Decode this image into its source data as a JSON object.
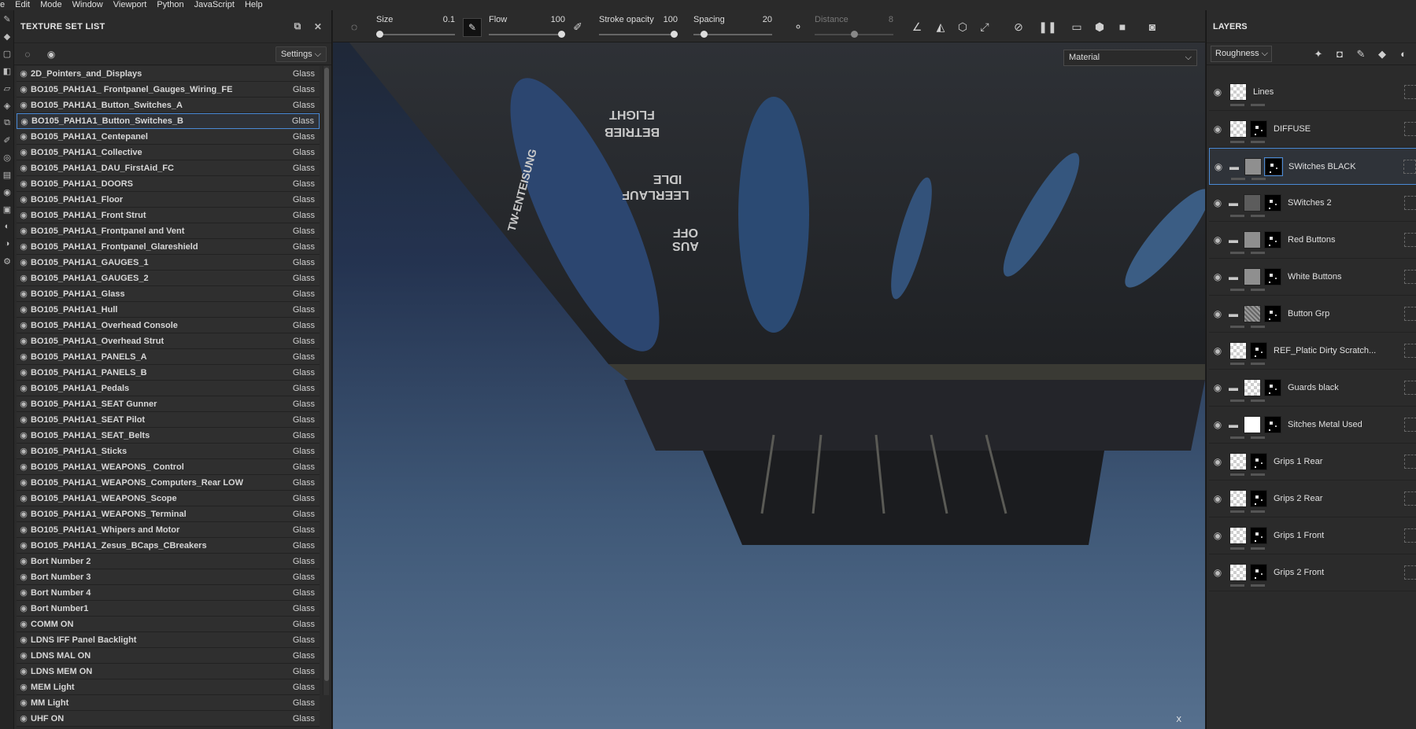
{
  "menu": [
    "e",
    "Edit",
    "Mode",
    "Window",
    "Viewport",
    "Python",
    "JavaScript",
    "Help"
  ],
  "texture_set_list": {
    "title": "TEXTURE SET LIST",
    "settings_label": "Settings",
    "settings_arrow": "⌵",
    "items": [
      {
        "name": "2D_Pointers_and_Displays",
        "shader": "Glass"
      },
      {
        "name": "BO105_PAH1A1_ Frontpanel_Gauges_Wiring_FE",
        "shader": "Glass"
      },
      {
        "name": "BO105_PAH1A1_Button_Switches_A",
        "shader": "Glass"
      },
      {
        "name": "BO105_PAH1A1_Button_Switches_B",
        "shader": "Glass",
        "selected": true
      },
      {
        "name": "BO105_PAH1A1_Centepanel",
        "shader": "Glass"
      },
      {
        "name": "BO105_PAH1A1_Collective",
        "shader": "Glass"
      },
      {
        "name": "BO105_PAH1A1_DAU_FirstAid_FC",
        "shader": "Glass"
      },
      {
        "name": "BO105_PAH1A1_DOORS",
        "shader": "Glass"
      },
      {
        "name": "BO105_PAH1A1_Floor",
        "shader": "Glass"
      },
      {
        "name": "BO105_PAH1A1_Front Strut",
        "shader": "Glass"
      },
      {
        "name": "BO105_PAH1A1_Frontpanel and Vent",
        "shader": "Glass"
      },
      {
        "name": "BO105_PAH1A1_Frontpanel_Glareshield",
        "shader": "Glass"
      },
      {
        "name": "BO105_PAH1A1_GAUGES_1",
        "shader": "Glass"
      },
      {
        "name": "BO105_PAH1A1_GAUGES_2",
        "shader": "Glass"
      },
      {
        "name": "BO105_PAH1A1_Glass",
        "shader": "Glass"
      },
      {
        "name": "BO105_PAH1A1_Hull",
        "shader": "Glass"
      },
      {
        "name": "BO105_PAH1A1_Overhead Console",
        "shader": "Glass"
      },
      {
        "name": "BO105_PAH1A1_Overhead Strut",
        "shader": "Glass"
      },
      {
        "name": "BO105_PAH1A1_PANELS_A",
        "shader": "Glass"
      },
      {
        "name": "BO105_PAH1A1_PANELS_B",
        "shader": "Glass"
      },
      {
        "name": "BO105_PAH1A1_Pedals",
        "shader": "Glass"
      },
      {
        "name": "BO105_PAH1A1_SEAT Gunner",
        "shader": "Glass"
      },
      {
        "name": "BO105_PAH1A1_SEAT Pilot",
        "shader": "Glass"
      },
      {
        "name": "BO105_PAH1A1_SEAT_Belts",
        "shader": "Glass"
      },
      {
        "name": "BO105_PAH1A1_Sticks",
        "shader": "Glass"
      },
      {
        "name": "BO105_PAH1A1_WEAPONS_ Control",
        "shader": "Glass"
      },
      {
        "name": "BO105_PAH1A1_WEAPONS_Computers_Rear LOW",
        "shader": "Glass"
      },
      {
        "name": "BO105_PAH1A1_WEAPONS_Scope",
        "shader": "Glass"
      },
      {
        "name": "BO105_PAH1A1_WEAPONS_Terminal",
        "shader": "Glass"
      },
      {
        "name": "BO105_PAH1A1_Whipers and Motor",
        "shader": "Glass"
      },
      {
        "name": "BO105_PAH1A1_Zesus_BCaps_CBreakers",
        "shader": "Glass"
      },
      {
        "name": "Bort Number 2",
        "shader": "Glass"
      },
      {
        "name": "Bort Number 3",
        "shader": "Glass"
      },
      {
        "name": "Bort Number 4",
        "shader": "Glass"
      },
      {
        "name": "Bort Number1",
        "shader": "Glass"
      },
      {
        "name": "COMM ON",
        "shader": "Glass"
      },
      {
        "name": "LDNS  IFF Panel Backlight",
        "shader": "Glass"
      },
      {
        "name": "LDNS MAL ON",
        "shader": "Glass"
      },
      {
        "name": "LDNS MEM ON",
        "shader": "Glass"
      },
      {
        "name": "MEM Light",
        "shader": "Glass"
      },
      {
        "name": "MM Light",
        "shader": "Glass"
      },
      {
        "name": "UHF ON",
        "shader": "Glass"
      }
    ]
  },
  "viewport": {
    "size": {
      "label": "Size",
      "value": "0.1",
      "fraction": 0.0
    },
    "flow": {
      "label": "Flow",
      "value": "100",
      "fraction": 1.0
    },
    "stroke_opacity": {
      "label": "Stroke opacity",
      "value": "100",
      "fraction": 1.0
    },
    "spacing": {
      "label": "Spacing",
      "value": "20",
      "fraction": 0.1
    },
    "distance": {
      "label": "Distance",
      "value": "8",
      "fraction": 0.5
    },
    "material_mode": "Material",
    "material_arrow": "⌵",
    "axis_label": "X"
  },
  "layers": {
    "title": "LAYERS",
    "channel": "Roughness",
    "channel_arrow": "⌵",
    "items": [
      {
        "name": "Lines",
        "folder": false,
        "thumb": "checker",
        "mask": null
      },
      {
        "name": "DIFFUSE",
        "folder": false,
        "thumb": "checker",
        "mask": "mask"
      },
      {
        "name": "SWitches BLACK",
        "folder": true,
        "thumb": "grey",
        "mask": "mask",
        "selected": true
      },
      {
        "name": "SWitches 2",
        "folder": true,
        "thumb": "darkgrey",
        "mask": "mask"
      },
      {
        "name": "Red Buttons",
        "folder": true,
        "thumb": "grey",
        "mask": "mask"
      },
      {
        "name": "White Buttons",
        "folder": true,
        "thumb": "grey",
        "mask": "mask"
      },
      {
        "name": "Button Grp",
        "folder": true,
        "thumb": "noise",
        "mask": "mask"
      },
      {
        "name": "REF_Platic Dirty Scratch...",
        "folder": false,
        "thumb": "checker",
        "mask": "mask"
      },
      {
        "name": "Guards black",
        "folder": true,
        "thumb": "checker",
        "mask": "mask"
      },
      {
        "name": "Sitches Metal Used",
        "folder": true,
        "thumb": "white",
        "mask": "mask"
      },
      {
        "name": "Grips 1 Rear",
        "folder": false,
        "thumb": "checker",
        "mask": "mask"
      },
      {
        "name": "Grips 2 Rear",
        "folder": false,
        "thumb": "checker",
        "mask": "mask"
      },
      {
        "name": "Grips 1 Front",
        "folder": false,
        "thumb": "checker",
        "mask": "mask"
      },
      {
        "name": "Grips 2 Front",
        "folder": false,
        "thumb": "checker",
        "mask": "mask"
      }
    ]
  },
  "panel_text": {
    "betrieb": "BETRIEB",
    "flight": "FLIGHT",
    "leerlauf": "LEERLAUF",
    "idle": "IDLE",
    "aus": "AUS",
    "off": "OFF",
    "tw": "TW-ENTEISUNG"
  },
  "colors": {
    "accent": "#4a8ad6",
    "panel_bg": "#2b2b2b"
  }
}
